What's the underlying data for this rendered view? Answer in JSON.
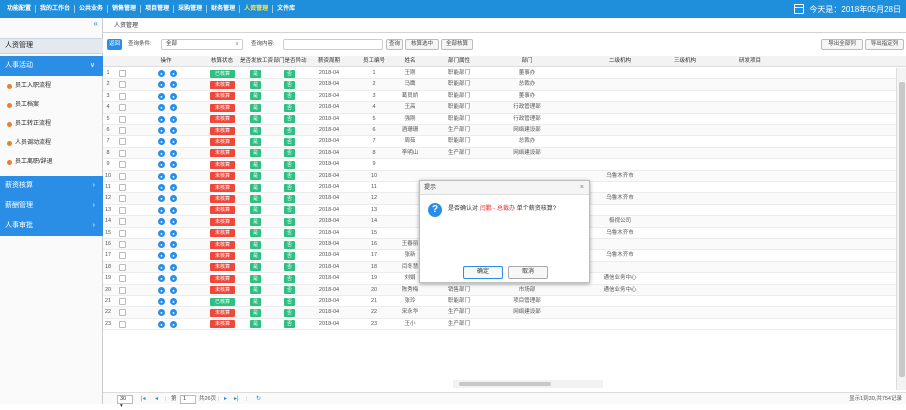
{
  "topnav": [
    "功能配置",
    "我的工作台",
    "公共业务",
    "销售管理",
    "项目管理",
    "采购管理",
    "财务管理",
    "人资管理",
    "文件库"
  ],
  "active_nav": "人资管理",
  "today_label": "今天是：2018年05月28日",
  "sidebar": {
    "collapse_icon": "«",
    "title": "人资管理",
    "menus": [
      {
        "label": "人事活动",
        "chev": "∨"
      },
      {
        "label": "薪资核算",
        "chev": "›"
      },
      {
        "label": "薪酬管理",
        "chev": "›"
      },
      {
        "label": "人事审批",
        "chev": "›"
      }
    ],
    "subitems": [
      "员工入职流程",
      "员工档案",
      "员工转正流程",
      "人员调动流程",
      "员工离职/辞退"
    ]
  },
  "tab_label": "人资管理",
  "toolbar": {
    "back": "返回",
    "cond_label": "查询条件:",
    "cond_value": "全部",
    "content_label": "查询内容:",
    "search": "查询",
    "check_selected": "核算选中",
    "check_all": "全部核算",
    "export_all": "导出全部列",
    "export_selected": "导出指定列"
  },
  "columns": [
    "",
    "",
    "操作",
    "核算状态",
    "是否发放工资",
    "部门是否异动",
    "薪资周期",
    "员工编号",
    "姓名",
    "部门属性",
    "部门",
    "二级机构",
    "三级机构",
    "研发项目"
  ],
  "rows": [
    {
      "n": "1",
      "status": "已核算",
      "done": true,
      "pay": "是",
      "change": "否",
      "period": "2018-04",
      "no": "1",
      "name": "王刚",
      "attr": "职能部门",
      "dept": "董事办",
      "org2": ""
    },
    {
      "n": "2",
      "status": "未核算",
      "done": false,
      "pay": "是",
      "change": "否",
      "period": "2018-04",
      "no": "2",
      "name": "马鹰",
      "attr": "职能部门",
      "dept": "总裁办",
      "org2": ""
    },
    {
      "n": "3",
      "status": "未核算",
      "done": false,
      "pay": "是",
      "change": "否",
      "period": "2018-04",
      "no": "3",
      "name": "葛员娇",
      "attr": "职能部门",
      "dept": "董事办",
      "org2": ""
    },
    {
      "n": "4",
      "status": "未核算",
      "done": false,
      "pay": "是",
      "change": "否",
      "period": "2018-04",
      "no": "4",
      "name": "王高",
      "attr": "职能部门",
      "dept": "行政管理部",
      "org2": ""
    },
    {
      "n": "5",
      "status": "未核算",
      "done": false,
      "pay": "是",
      "change": "否",
      "period": "2018-04",
      "no": "5",
      "name": "强刚",
      "attr": "职能部门",
      "dept": "行政管理部",
      "org2": ""
    },
    {
      "n": "6",
      "status": "未核算",
      "done": false,
      "pay": "是",
      "change": "否",
      "period": "2018-04",
      "no": "6",
      "name": "酒珊珊",
      "attr": "生产部门",
      "dept": "网络建设部",
      "org2": ""
    },
    {
      "n": "7",
      "status": "未核算",
      "done": false,
      "pay": "是",
      "change": "否",
      "period": "2018-04",
      "no": "7",
      "name": "周茹",
      "attr": "职能部门",
      "dept": "总裁办",
      "org2": ""
    },
    {
      "n": "8",
      "status": "未核算",
      "done": false,
      "pay": "是",
      "change": "否",
      "period": "2018-04",
      "no": "8",
      "name": "李明山",
      "attr": "生产部门",
      "dept": "网络建设部",
      "org2": ""
    },
    {
      "n": "9",
      "status": "未核算",
      "done": false,
      "pay": "是",
      "change": "否",
      "period": "2018-04",
      "no": "9",
      "name": "",
      "attr": "",
      "dept": "",
      "org2": ""
    },
    {
      "n": "10",
      "status": "未核算",
      "done": false,
      "pay": "是",
      "change": "否",
      "period": "2018-04",
      "no": "10",
      "name": "",
      "attr": "",
      "dept": "",
      "org2": "乌鲁木齐市"
    },
    {
      "n": "11",
      "status": "未核算",
      "done": false,
      "pay": "是",
      "change": "否",
      "period": "2018-04",
      "no": "11",
      "name": "",
      "attr": "",
      "dept": "",
      "org2": ""
    },
    {
      "n": "12",
      "status": "未核算",
      "done": false,
      "pay": "是",
      "change": "否",
      "period": "2018-04",
      "no": "12",
      "name": "",
      "attr": "",
      "dept": "",
      "org2": "乌鲁木齐市"
    },
    {
      "n": "13",
      "status": "未核算",
      "done": false,
      "pay": "是",
      "change": "否",
      "period": "2018-04",
      "no": "13",
      "name": "",
      "attr": "",
      "dept": "",
      "org2": ""
    },
    {
      "n": "14",
      "status": "未核算",
      "done": false,
      "pay": "是",
      "change": "否",
      "period": "2018-04",
      "no": "14",
      "name": "",
      "attr": "",
      "dept": "",
      "org2": "极视公司"
    },
    {
      "n": "15",
      "status": "未核算",
      "done": false,
      "pay": "是",
      "change": "否",
      "period": "2018-04",
      "no": "15",
      "name": "",
      "attr": "",
      "dept": "",
      "org2": "乌鲁木齐市"
    },
    {
      "n": "16",
      "status": "未核算",
      "done": false,
      "pay": "是",
      "change": "否",
      "period": "2018-04",
      "no": "16",
      "name": "王春丽",
      "attr": "职能部门",
      "dept": "行政管理部",
      "org2": ""
    },
    {
      "n": "17",
      "status": "未核算",
      "done": false,
      "pay": "是",
      "change": "否",
      "period": "2018-04",
      "no": "17",
      "name": "张新",
      "attr": "生产部门",
      "dept": "网络维护部",
      "org2": "乌鲁木齐市"
    },
    {
      "n": "18",
      "status": "未核算",
      "done": false,
      "pay": "是",
      "change": "否",
      "period": "2018-04",
      "no": "18",
      "name": "闫冬慧",
      "attr": "职能部门",
      "dept": "行政管理部",
      "org2": ""
    },
    {
      "n": "19",
      "status": "未核算",
      "done": false,
      "pay": "是",
      "change": "否",
      "period": "2018-04",
      "no": "19",
      "name": "刘娟",
      "attr": "销售部门",
      "dept": "市场部",
      "org2": "通信业务中心"
    },
    {
      "n": "20",
      "status": "未核算",
      "done": false,
      "pay": "是",
      "change": "否",
      "period": "2018-04",
      "no": "20",
      "name": "陈秀梅",
      "attr": "销售部门",
      "dept": "市场部",
      "org2": "通信业务中心"
    },
    {
      "n": "21",
      "status": "已核算",
      "done": true,
      "pay": "是",
      "change": "否",
      "period": "2018-04",
      "no": "21",
      "name": "张玲",
      "attr": "职能部门",
      "dept": "项目管理部",
      "org2": ""
    },
    {
      "n": "22",
      "status": "未核算",
      "done": false,
      "pay": "是",
      "change": "否",
      "period": "2018-04",
      "no": "22",
      "name": "宋永华",
      "attr": "生产部门",
      "dept": "网络建设部",
      "org2": ""
    },
    {
      "n": "23",
      "status": "未核算",
      "done": false,
      "pay": "是",
      "change": "否",
      "period": "2018-04",
      "no": "23",
      "name": "王小",
      "attr": "生产部门",
      "dept": "",
      "org2": ""
    }
  ],
  "action_icons": [
    "view",
    "edit"
  ],
  "pager": {
    "size": "30",
    "page_label": "第",
    "page": "1",
    "total_pages": "共26页",
    "summary": "显示1到30,共754记录"
  },
  "dialog": {
    "title": "提示",
    "close": "×",
    "msg_pre": "是否确认对",
    "msg_name": "闫鹏 - 总裁办",
    "msg_post": "单个薪资核算?",
    "ok": "确定",
    "cancel": "取消"
  }
}
